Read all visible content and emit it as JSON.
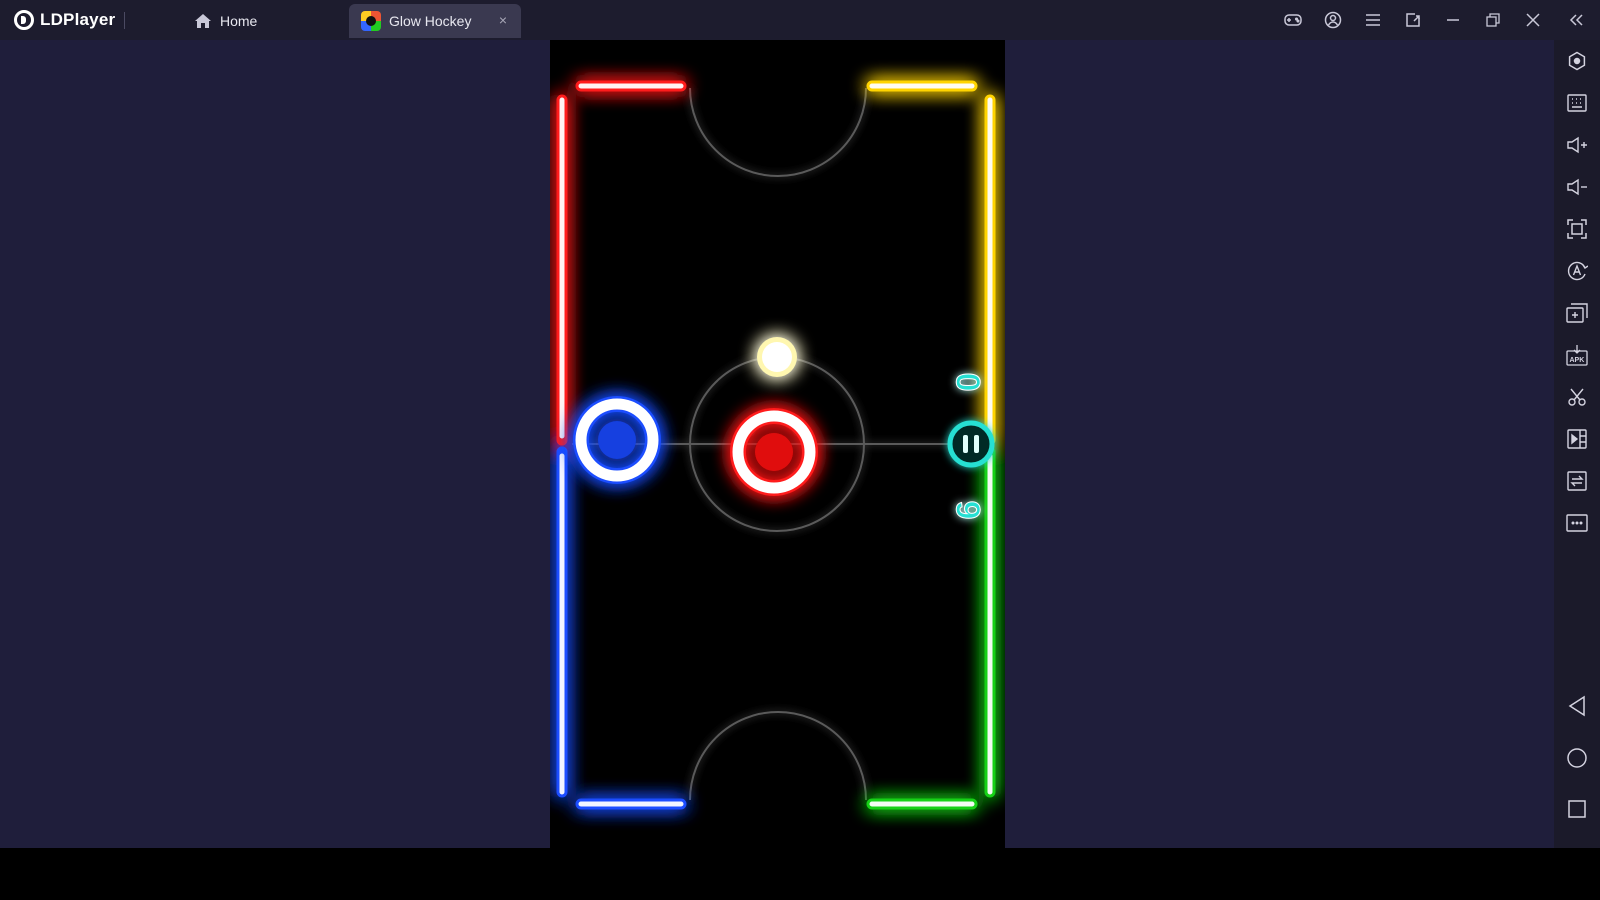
{
  "app": {
    "name": "LDPlayer"
  },
  "tabs": [
    {
      "label": "Home",
      "icon": "home-icon"
    },
    {
      "label": "Glow Hockey",
      "icon": "glow-hockey-thumbnail",
      "close": "×"
    }
  ],
  "window_controls": [
    "gamepad-icon",
    "account-icon",
    "menu-icon",
    "screen-rotate-icon",
    "minimize-icon",
    "restore-icon",
    "close-icon",
    "collapse-sidebar-icon"
  ],
  "toolbar": [
    "settings-icon",
    "keyboard-mapping-icon",
    "volume-up-icon",
    "volume-down-icon",
    "fullscreen-icon",
    "auto-operation-icon",
    "add-window-icon",
    "install-apk-icon",
    "screenshot-icon",
    "record-icon",
    "shared-folder-icon",
    "more-options-icon",
    "back-icon",
    "home-nav-icon",
    "recent-apps-icon"
  ],
  "game": {
    "title": "Glow Hockey",
    "score_top": "0",
    "score_bottom": "6",
    "colors": {
      "top_left": "#ff1a1a",
      "top_right": "#ffd400",
      "bottom_left": "#1a4dff",
      "bottom_right": "#19d119",
      "player_paddle": "#1a4dff",
      "opponent_paddle": "#ff1a1a",
      "puck": "#ffe94d",
      "score": "#27e0d3"
    }
  }
}
